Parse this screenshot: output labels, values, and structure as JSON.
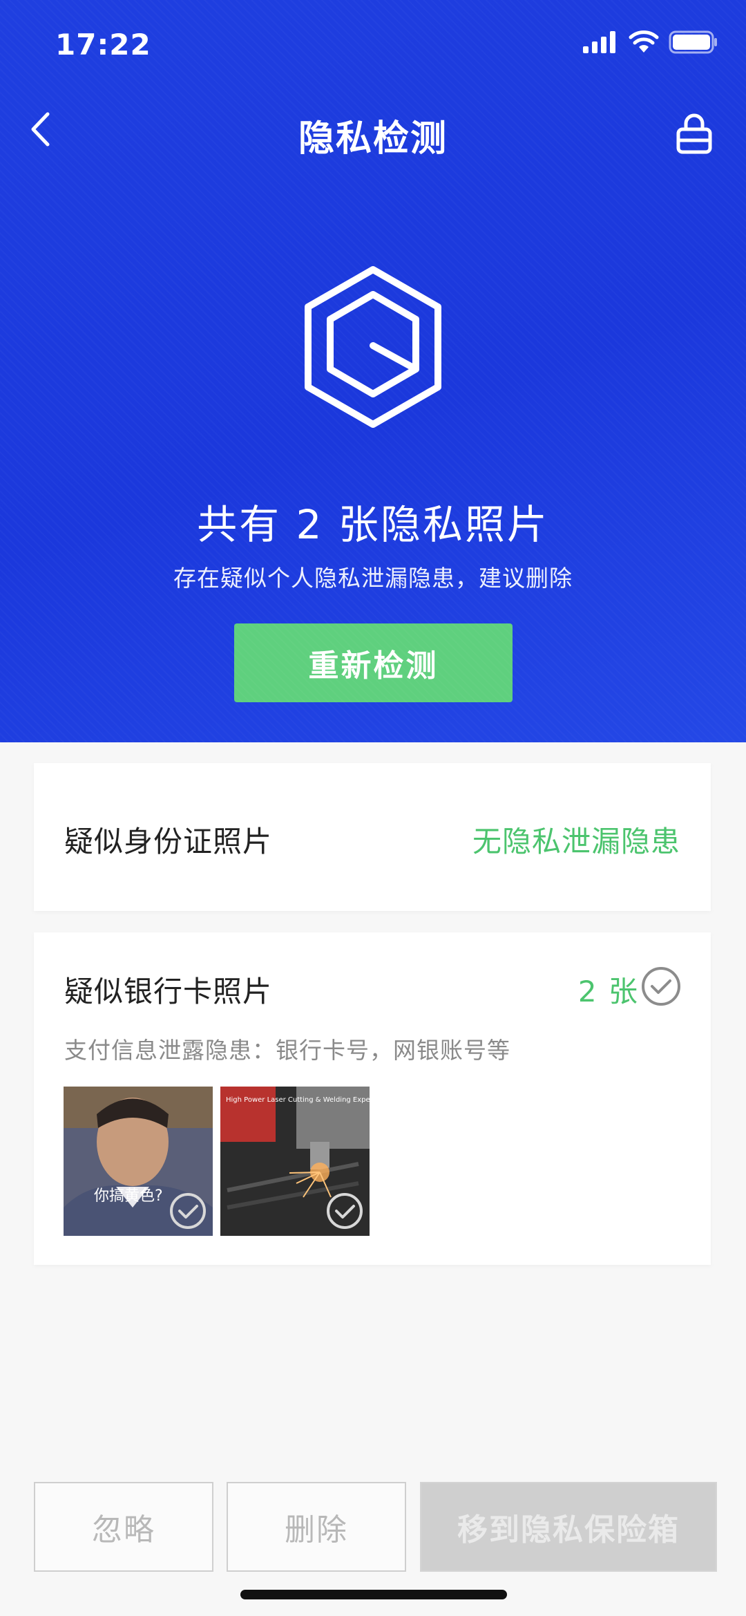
{
  "status_bar": {
    "time": "17:22"
  },
  "nav": {
    "title": "隐私检测"
  },
  "hero": {
    "headline": "共有 2 张隐私照片",
    "subline": "存在疑似个人隐私泄漏隐患，建议删除",
    "rescan_label": "重新检测"
  },
  "cards": {
    "id_card": {
      "title": "疑似身份证照片",
      "status": "无隐私泄漏隐患"
    },
    "bank_card": {
      "title": "疑似银行卡照片",
      "count": "2 张",
      "description": "支付信息泄露隐患：银行卡号，网银账号等",
      "thumbnails": [
        {
          "caption": "你搞黄色?"
        },
        {
          "caption": "High Power Laser Cutting & Welding Expert"
        }
      ]
    }
  },
  "actions": {
    "ignore": "忽略",
    "delete": "删除",
    "move": "移到隐私保险箱"
  },
  "colors": {
    "hero_blue": "#1f3fe0",
    "green": "#5fd07e",
    "status_green": "#4cc46e"
  },
  "icons": [
    "signal-icon",
    "wifi-icon",
    "battery-icon",
    "back-arrow-icon",
    "lock-icon",
    "hexagon-logo-icon",
    "check-circle-icon"
  ]
}
